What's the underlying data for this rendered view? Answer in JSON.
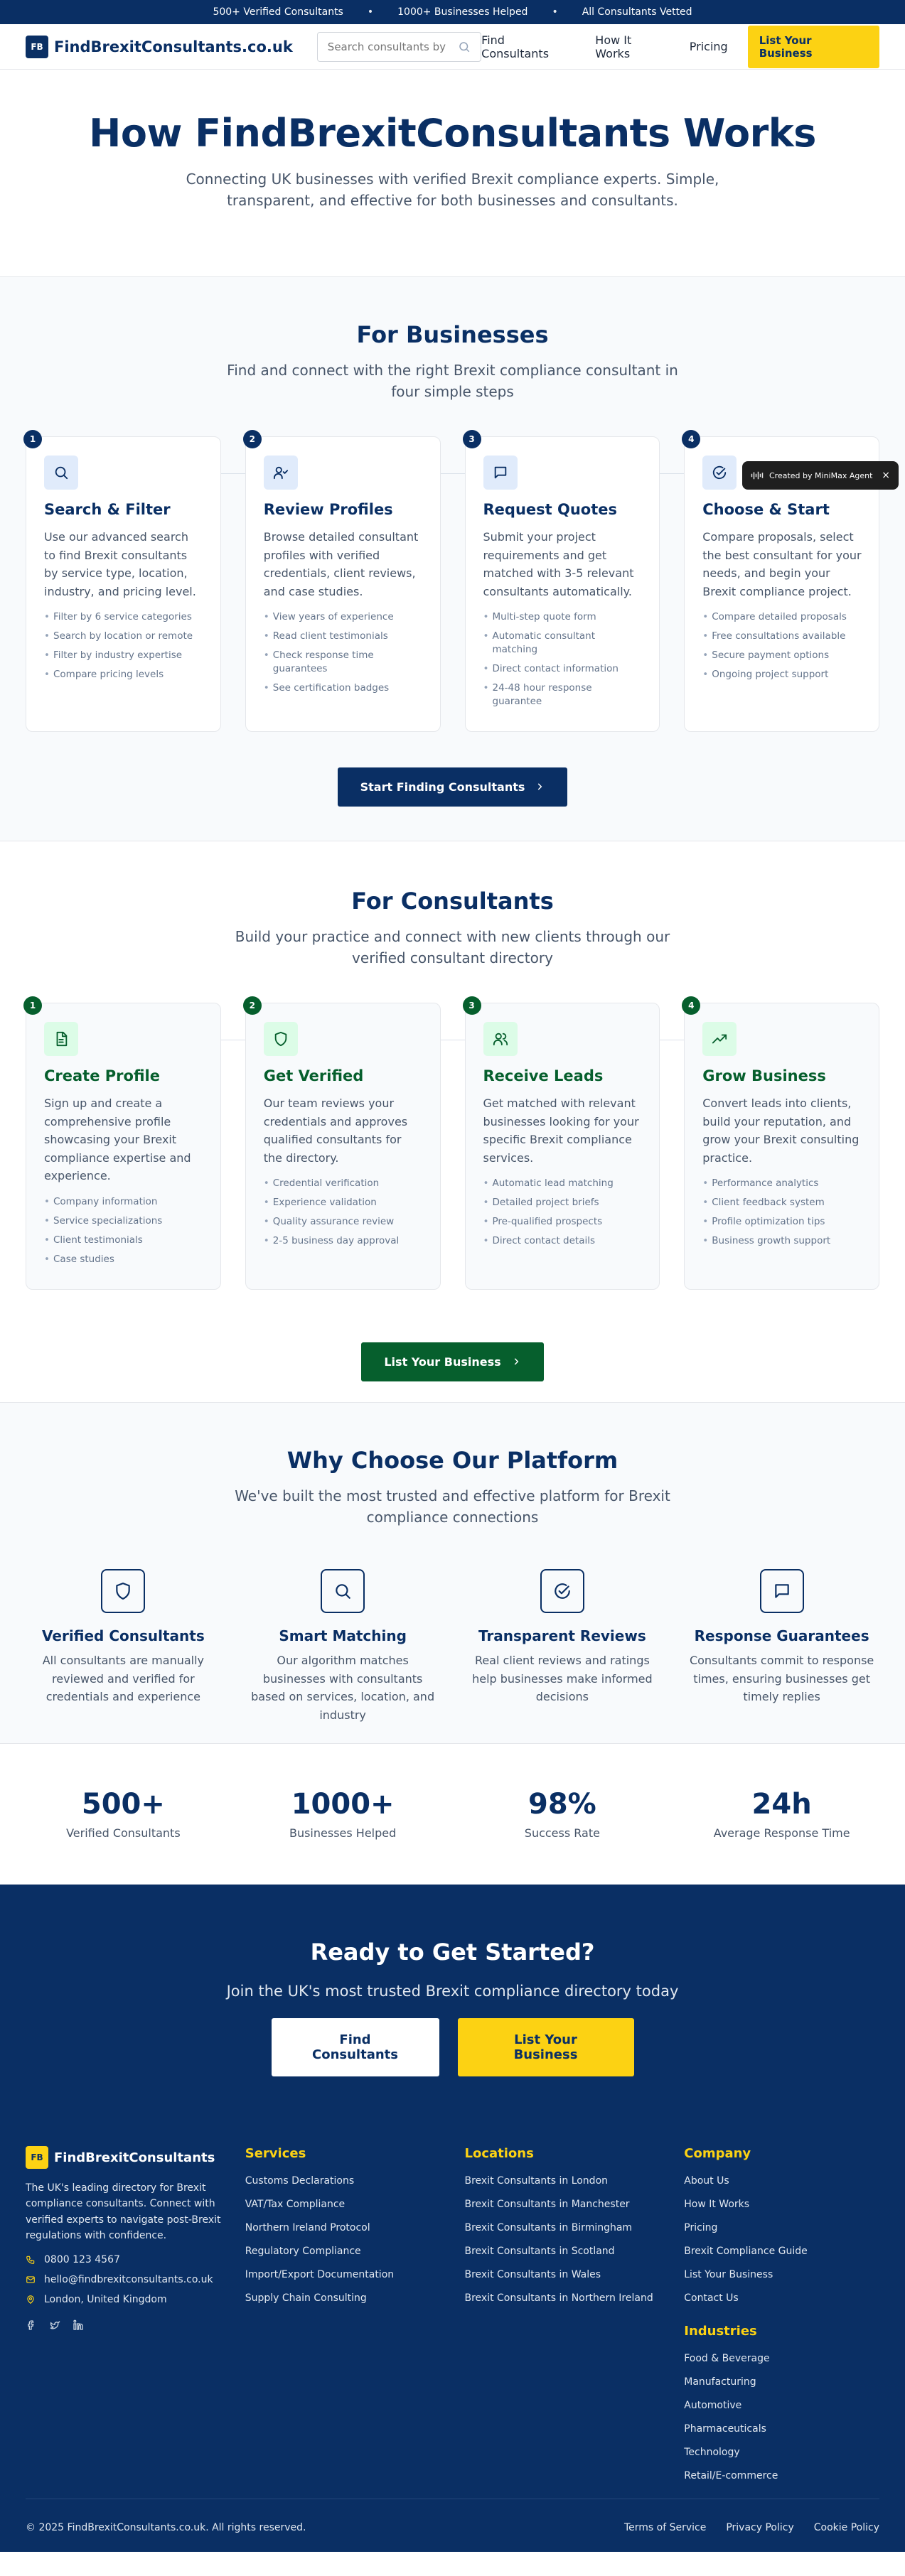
{
  "topbar": {
    "items": [
      "500+ Verified Consultants",
      "1000+ Businesses Helped",
      "All Consultants Vetted"
    ]
  },
  "nav": {
    "logo_mark": "FB",
    "logo_text": "FindBrexitConsultants.co.uk",
    "search_placeholder": "Search consultants by",
    "links": [
      "Find Consultants",
      "How It Works",
      "Pricing"
    ],
    "cta": "List Your Business"
  },
  "hero": {
    "title": "How FindBrexitConsultants Works",
    "subtitle": "Connecting UK businesses with verified Brexit compliance experts. Simple, transparent, and effective for both businesses and consultants."
  },
  "businesses": {
    "title": "For Businesses",
    "subtitle": "Find and connect with the right Brexit compliance consultant in four simple steps",
    "cta": "Start Finding Consultants",
    "steps": [
      {
        "num": "1",
        "icon": "search-icon",
        "title": "Search & Filter",
        "desc": "Use our advanced search to find Brexit consultants by service type, location, industry, and pricing level.",
        "bullets": [
          "Filter by 6 service categories",
          "Search by location or remote",
          "Filter by industry expertise",
          "Compare pricing levels"
        ]
      },
      {
        "num": "2",
        "icon": "user-check-icon",
        "title": "Review Profiles",
        "desc": "Browse detailed consultant profiles with verified credentials, client reviews, and case studies.",
        "bullets": [
          "View years of experience",
          "Read client testimonials",
          "Check response time guarantees",
          "See certification badges"
        ]
      },
      {
        "num": "3",
        "icon": "message-icon",
        "title": "Request Quotes",
        "desc": "Submit your project requirements and get matched with 3-5 relevant consultants automatically.",
        "bullets": [
          "Multi-step quote form",
          "Automatic consultant matching",
          "Direct contact information",
          "24-48 hour response guarantee"
        ]
      },
      {
        "num": "4",
        "icon": "check-circle-icon",
        "title": "Choose & Start",
        "desc": "Compare proposals, select the best consultant for your needs, and begin your Brexit compliance project.",
        "bullets": [
          "Compare detailed proposals",
          "Free consultations available",
          "Secure payment options",
          "Ongoing project support"
        ]
      }
    ]
  },
  "consultants": {
    "title": "For Consultants",
    "subtitle": "Build your practice and connect with new clients through our verified consultant directory",
    "cta": "List Your Business",
    "steps": [
      {
        "num": "1",
        "icon": "document-icon",
        "title": "Create Profile",
        "desc": "Sign up and create a comprehensive profile showcasing your Brexit compliance expertise and experience.",
        "bullets": [
          "Company information",
          "Service specializations",
          "Client testimonials",
          "Case studies"
        ]
      },
      {
        "num": "2",
        "icon": "shield-icon",
        "title": "Get Verified",
        "desc": "Our team reviews your credentials and approves qualified consultants for the directory.",
        "bullets": [
          "Credential verification",
          "Experience validation",
          "Quality assurance review",
          "2-5 business day approval"
        ]
      },
      {
        "num": "3",
        "icon": "users-icon",
        "title": "Receive Leads",
        "desc": "Get matched with relevant businesses looking for your specific Brexit compliance services.",
        "bullets": [
          "Automatic lead matching",
          "Detailed project briefs",
          "Pre-qualified prospects",
          "Direct contact details"
        ]
      },
      {
        "num": "4",
        "icon": "trending-up-icon",
        "title": "Grow Business",
        "desc": "Convert leads into clients, build your reputation, and grow your Brexit consulting practice.",
        "bullets": [
          "Performance analytics",
          "Client feedback system",
          "Profile optimization tips",
          "Business growth support"
        ]
      }
    ]
  },
  "why": {
    "title": "Why Choose Our Platform",
    "subtitle": "We've built the most trusted and effective platform for Brexit compliance connections",
    "features": [
      {
        "icon": "shield-icon",
        "title": "Verified Consultants",
        "desc": "All consultants are manually reviewed and verified for credentials and experience"
      },
      {
        "icon": "search-icon",
        "title": "Smart Matching",
        "desc": "Our algorithm matches businesses with consultants based on services, location, and industry"
      },
      {
        "icon": "check-circle-icon",
        "title": "Transparent Reviews",
        "desc": "Real client reviews and ratings help businesses make informed decisions"
      },
      {
        "icon": "message-icon",
        "title": "Response Guarantees",
        "desc": "Consultants commit to response times, ensuring businesses get timely replies"
      }
    ]
  },
  "stats": [
    {
      "value": "500+",
      "label": "Verified Consultants"
    },
    {
      "value": "1000+",
      "label": "Businesses Helped"
    },
    {
      "value": "98%",
      "label": "Success Rate"
    },
    {
      "value": "24h",
      "label": "Average Response Time"
    }
  ],
  "cta": {
    "title": "Ready to Get Started?",
    "subtitle": "Join the UK's most trusted Brexit compliance directory today",
    "primary": "Find Consultants",
    "secondary": "List Your Business"
  },
  "footer": {
    "logo_mark": "FB",
    "logo_text": "FindBrexitConsultants",
    "desc": "The UK's leading directory for Brexit compliance consultants. Connect with verified experts to navigate post-Brexit regulations with confidence.",
    "phone": "0800 123 4567",
    "email": "hello@findbrexitconsultants.co.uk",
    "address": "London, United Kingdom",
    "services_title": "Services",
    "services": [
      "Customs Declarations",
      "VAT/Tax Compliance",
      "Northern Ireland Protocol",
      "Regulatory Compliance",
      "Import/Export Documentation",
      "Supply Chain Consulting"
    ],
    "locations_title": "Locations",
    "locations": [
      "Brexit Consultants in London",
      "Brexit Consultants in Manchester",
      "Brexit Consultants in Birmingham",
      "Brexit Consultants in Scotland",
      "Brexit Consultants in Wales",
      "Brexit Consultants in Northern Ireland"
    ],
    "company_title": "Company",
    "company": [
      "About Us",
      "How It Works",
      "Pricing",
      "Brexit Compliance Guide",
      "List Your Business",
      "Contact Us"
    ],
    "industries_title": "Industries",
    "industries": [
      "Food & Beverage",
      "Manufacturing",
      "Automotive",
      "Pharmaceuticals",
      "Technology",
      "Retail/E-commerce"
    ],
    "copyright": "© 2025 FindBrexitConsultants.co.uk. All rights reserved.",
    "legal": [
      "Terms of Service",
      "Privacy Policy",
      "Cookie Policy"
    ]
  },
  "toast": {
    "text": "Created by MiniMax Agent",
    "close": "×"
  },
  "colors": {
    "navy": "#0a2f64",
    "yellow": "#fcd213",
    "green": "#065f2d"
  }
}
